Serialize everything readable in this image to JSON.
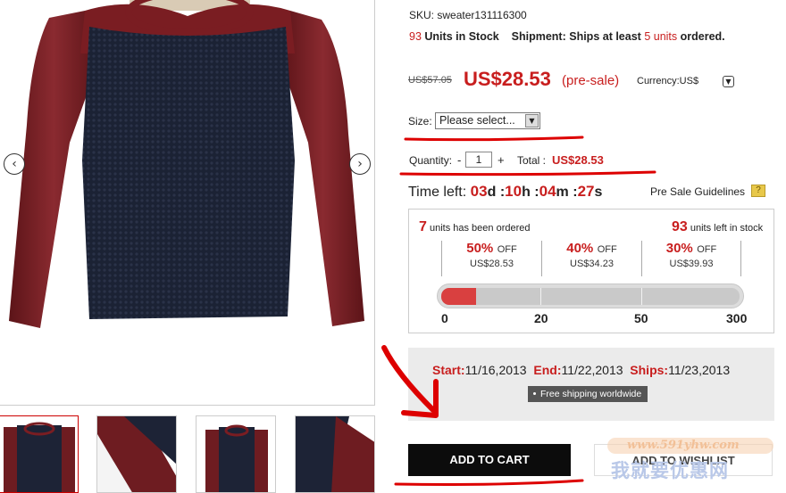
{
  "product": {
    "sku_label": "SKU:",
    "sku": "sweater131116300",
    "stock_count": "93",
    "stock_text": "Units in Stock",
    "shipment_label": "Shipment:",
    "shipment_pre": "Ships at least",
    "shipment_days": "5 units",
    "shipment_post": "ordered.",
    "old_price": "US$57.05",
    "price": "US$28.53",
    "presale": "(pre-sale)",
    "currency_label": "Currency:US$",
    "size_label": "Size:",
    "size_value": "Please select...",
    "qty_label": "Quantity:",
    "qty_minus": "-",
    "qty_value": "1",
    "qty_plus": "+",
    "total_label": "Total :",
    "total_value": "US$28.53"
  },
  "timer": {
    "label": "Time left:",
    "days": "03",
    "d_unit": "d",
    "hours": "10",
    "h_unit": "h",
    "minutes": "04",
    "m_unit": "m",
    "seconds": "27",
    "s_unit": "s",
    "sep": ":",
    "guide_label": "Pre Sale Guidelines"
  },
  "progress": {
    "ordered_count": "7",
    "ordered_text": "units has been ordered",
    "left_count": "93",
    "left_text": "units left in stock",
    "tiers": [
      {
        "pct": "50%",
        "off": "OFF",
        "price": "US$28.53"
      },
      {
        "pct": "40%",
        "off": "OFF",
        "price": "US$34.23"
      },
      {
        "pct": "30%",
        "off": "OFF",
        "price": "US$39.93"
      }
    ],
    "scale": [
      "0",
      "20",
      "50",
      "300"
    ],
    "ordered_value": 7,
    "max_value": 300
  },
  "dates": {
    "start_label": "Start:",
    "start": "11/16,2013",
    "end_label": "End:",
    "end": "11/22,2013",
    "ships_label": "Ships:",
    "ships": "11/23,2013",
    "shipping_badge": "Free shipping worldwide"
  },
  "buttons": {
    "cart": "ADD TO CART",
    "wishlist": "ADD TO WISHLIST"
  },
  "watermark": {
    "url": "www.591yhw.com",
    "text": "我就要优惠网"
  },
  "colors": {
    "accent_red": "#c81e1e",
    "sweater_body": "#1d2336",
    "sleeve": "#7a1d22"
  }
}
